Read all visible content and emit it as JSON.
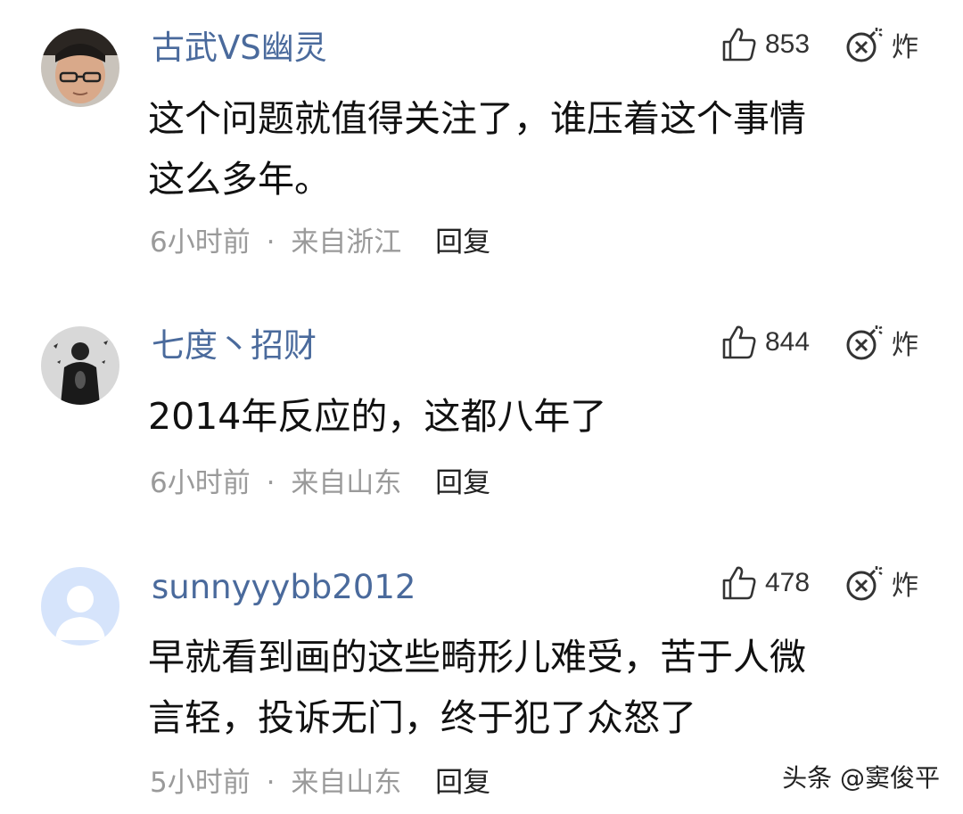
{
  "comments": [
    {
      "username": "古武VS幽灵",
      "likes": "853",
      "bomb_label": "炸",
      "text": "这个问题就值得关注了，谁压着这个事情\n这么多年。",
      "time": "6小时前",
      "separator": "·",
      "location": "来自浙江",
      "reply": "回复",
      "avatar_desc": "man-with-glasses"
    },
    {
      "username": "七度丶招财",
      "likes": "844",
      "bomb_label": "炸",
      "text": "2014年反应的，这都八年了",
      "time": "6小时前",
      "separator": "·",
      "location": "来自山东",
      "reply": "回复",
      "avatar_desc": "dark-figure"
    },
    {
      "username": "sunnyyybb2012",
      "likes": "478",
      "bomb_label": "炸",
      "text": "早就看到画的这些畸形儿难受，苦于人微\n言轻，投诉无门，终于犯了众怒了",
      "time": "5小时前",
      "separator": "·",
      "location": "来自山东",
      "reply": "回复",
      "avatar_desc": "default-avatar"
    }
  ],
  "watermark": "头条 @窦俊平",
  "colors": {
    "username": "#4a6a9c",
    "meta": "#9a9a9a",
    "text": "#111111"
  }
}
